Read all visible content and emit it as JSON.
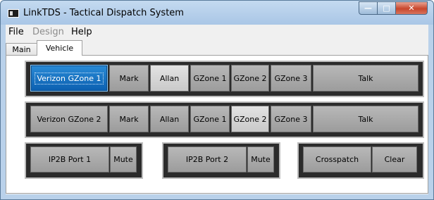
{
  "window": {
    "title": "LinkTDS - Tactical Dispatch System",
    "controls": {
      "minimize": "—",
      "maximize": "□",
      "close": "✕"
    }
  },
  "menu": {
    "file": "File",
    "design": "Design",
    "help": "Help"
  },
  "tabs": {
    "main": "Main",
    "vehicle": "Vehicle"
  },
  "rows": [
    {
      "buttons": [
        "Verizon GZone 1",
        "Mark",
        "Allan",
        "GZone 1",
        "GZone 2",
        "GZone 3",
        "Talk"
      ]
    },
    {
      "buttons": [
        "Verizon GZone 2",
        "Mark",
        "Allan",
        "GZone 1",
        "GZone 2",
        "GZone 3",
        "Talk"
      ]
    }
  ],
  "ports": {
    "port1": "IP2B Port 1",
    "mute1": "Mute",
    "port2": "IP2B Port 2",
    "mute2": "Mute",
    "crosspatch": "Crosspatch",
    "clear": "Clear"
  },
  "colors": {
    "selected": "#0b5fb0",
    "row_bg": "#2b2b2b",
    "button": "#a8a8a8",
    "button_light": "#d6d6d6"
  }
}
